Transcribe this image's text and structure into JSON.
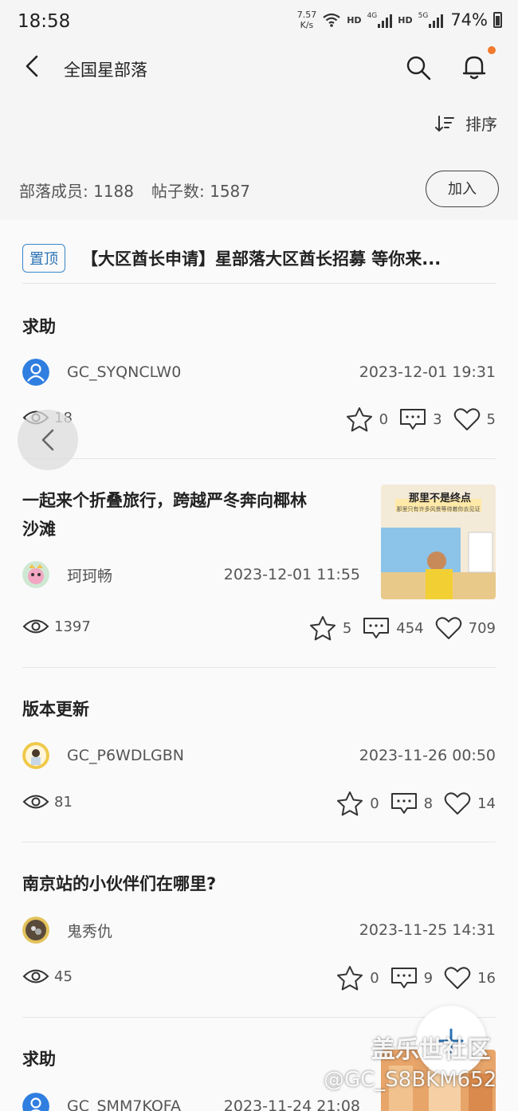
{
  "status": {
    "time": "18:58",
    "speed_value": "7.57",
    "speed_unit": "K/s",
    "hd1": "HD",
    "net1": "4G",
    "hd2": "HD",
    "net2": "5G",
    "battery": "74%"
  },
  "header": {
    "title": "全国星部落",
    "back_icon": "back-arrow-icon",
    "search_icon": "search-icon",
    "bell_icon": "bell-icon",
    "notification_dot_color": "#f07a2d"
  },
  "sort": {
    "label": "排序"
  },
  "stats": {
    "members": "部落成员: 1188",
    "posts": "帖子数: 1587",
    "join_label": "加入"
  },
  "pinned": {
    "badge": "置顶",
    "title": "【大区酋长申请】星部落大区酋长招募 等你来..."
  },
  "posts": [
    {
      "title": "求助",
      "author": "GC_SYQNCLW0",
      "date": "2023-12-01 19:31",
      "views": "18",
      "stars": "0",
      "comments": "3",
      "likes": "5"
    },
    {
      "title_line1": "一起来个折叠旅行，跨越严冬奔向椰林",
      "title_line2": "沙滩",
      "author": "珂珂畅",
      "date": "2023-12-01 11:55",
      "views": "1397",
      "stars": "5",
      "comments": "454",
      "likes": "709",
      "thumb_text": "那里不是终点",
      "thumb_sub": "那里只有许多风景等待着你去见证"
    },
    {
      "title": "版本更新",
      "author": "GC_P6WDLGBN",
      "date": "2023-11-26 00:50",
      "views": "81",
      "stars": "0",
      "comments": "8",
      "likes": "14"
    },
    {
      "title": "南京站的小伙伴们在哪里?",
      "author": "鬼秀仇",
      "date": "2023-11-25 14:31",
      "views": "45",
      "stars": "0",
      "comments": "9",
      "likes": "16"
    },
    {
      "title": "求助",
      "author": "GC_SMM7KOFA",
      "date": "2023-11-24 21:08"
    }
  ],
  "watermark": {
    "line1": "盖乐世社区",
    "line2": "@GC_S8BKM652"
  }
}
